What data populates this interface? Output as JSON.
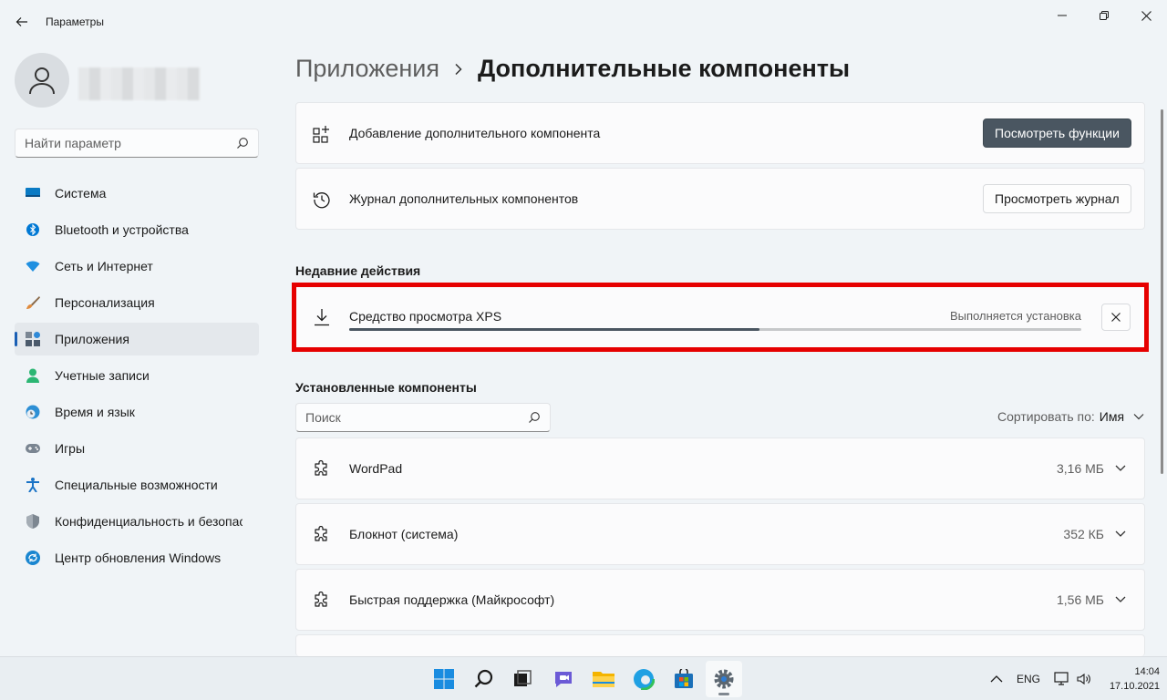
{
  "window": {
    "title": "Параметры"
  },
  "sidebar": {
    "search_placeholder": "Найти параметр",
    "items": [
      {
        "label": "Система",
        "icon": "monitor-icon",
        "color": "#0a7ac4"
      },
      {
        "label": "Bluetooth и устройства",
        "icon": "bluetooth-icon",
        "color": "#0078d4"
      },
      {
        "label": "Сеть и Интернет",
        "icon": "wifi-icon",
        "color": "#1f8fe0"
      },
      {
        "label": "Персонализация",
        "icon": "brush-icon",
        "color": "#e08a3c"
      },
      {
        "label": "Приложения",
        "icon": "apps-icon",
        "color": "#4b5a6b",
        "active": true
      },
      {
        "label": "Учетные записи",
        "icon": "person-icon",
        "color": "#2bb673"
      },
      {
        "label": "Время и язык",
        "icon": "clock-globe-icon",
        "color": "#2d8fd5"
      },
      {
        "label": "Игры",
        "icon": "gamepad-icon",
        "color": "#7a8591"
      },
      {
        "label": "Специальные возможности",
        "icon": "accessibility-icon",
        "color": "#1a73c6"
      },
      {
        "label": "Конфиденциальность и безопасность",
        "icon": "shield-icon",
        "color": "#7d8791"
      },
      {
        "label": "Центр обновления Windows",
        "icon": "update-icon",
        "color": "#1a86d0"
      }
    ]
  },
  "breadcrumb": {
    "parent": "Приложения",
    "current": "Дополнительные компоненты"
  },
  "cards": {
    "add": {
      "label": "Добавление дополнительного компонента",
      "button": "Посмотреть функции"
    },
    "history": {
      "label": "Журнал дополнительных компонентов",
      "button": "Просмотреть журнал"
    }
  },
  "recent": {
    "title": "Недавние действия",
    "item_name": "Средство просмотра XPS",
    "status": "Выполняется установка",
    "progress_percent": 56
  },
  "installed": {
    "title": "Установленные компоненты",
    "search_placeholder": "Поиск",
    "sort_label": "Сортировать по:",
    "sort_value": "Имя",
    "items": [
      {
        "name": "WordPad",
        "size": "3,16 МБ"
      },
      {
        "name": "Блокнот (система)",
        "size": "352 КБ"
      },
      {
        "name": "Быстрая поддержка (Майкрософт)",
        "size": "1,56 МБ"
      }
    ]
  },
  "taskbar": {
    "lang": "ENG",
    "time": "14:04",
    "date": "17.10.2021"
  },
  "colors": {
    "accent": "#1a5fb4",
    "highlight": "#e60000",
    "primary_button": "#4a5661"
  }
}
